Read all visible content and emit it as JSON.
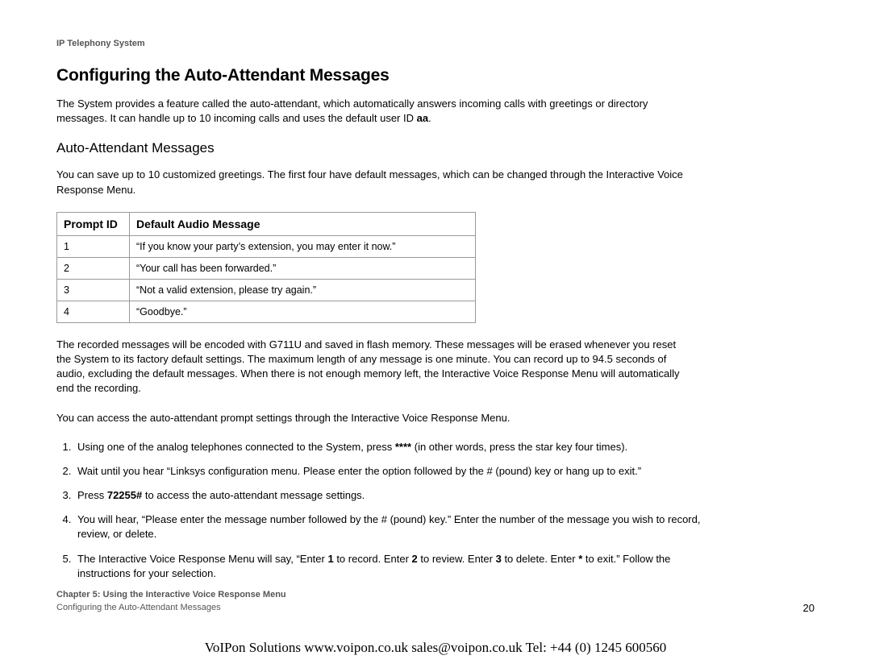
{
  "header_label": "IP Telephony System",
  "title": "Configuring the Auto-Attendant Messages",
  "intro_part1": "The System provides a feature called the auto-attendant, which automatically answers incoming calls with greetings or directory messages. It can handle up to 10 incoming calls and uses the default user ID ",
  "intro_bold": "aa",
  "intro_part2": ".",
  "subsection": "Auto-Attendant Messages",
  "save_text": "You can save up to 10 customized greetings. The first four have default messages, which can be changed through the Interactive Voice Response Menu.",
  "table": {
    "headers": {
      "col1": "Prompt ID",
      "col2": "Default Audio Message"
    },
    "rows": [
      {
        "id": "1",
        "msg": "“If you know your party’s extension, you may enter it now.”"
      },
      {
        "id": "2",
        "msg": "“Your call has been forwarded.”"
      },
      {
        "id": "3",
        "msg": "“Not a valid extension, please try again.”"
      },
      {
        "id": "4",
        "msg": "“Goodbye.”"
      }
    ]
  },
  "encoded_text": "The recorded messages will be encoded with G711U and saved in flash memory. These messages will be erased whenever you reset the System to its factory default settings. The maximum length of any message is one minute. You can record up to 94.5 seconds of audio, excluding the default messages. When there is not enough memory left, the Interactive Voice Response Menu will automatically end the recording.",
  "access_text": "You can access the auto-attendant prompt settings through the Interactive Voice Response Menu.",
  "steps": {
    "s1a": "Using one of the analog telephones connected to the System, press ",
    "s1b": "****",
    "s1c": " (in other words, press the star key four times).",
    "s2": "Wait until you hear “Linksys configuration menu. Please enter the option followed by the # (pound) key or hang up to exit.”",
    "s3a": "Press ",
    "s3b": "72255#",
    "s3c": " to access the auto-attendant message settings.",
    "s4": "You will hear, “Please enter the message number followed by the # (pound) key.” Enter the number of the message you wish to record, review, or delete.",
    "s5a": "The Interactive Voice Response Menu will say, “Enter ",
    "s5b": "1",
    "s5c": " to record. Enter ",
    "s5d": "2",
    "s5e": " to review. Enter ",
    "s5f": "3",
    "s5g": " to delete. Enter ",
    "s5h": "*",
    "s5i": " to exit.” Follow the instructions for your selection."
  },
  "footer": {
    "line1": "Chapter 5: Using the Interactive Voice Response Menu",
    "line2": "Configuring the Auto-Attendant Messages",
    "page": "20"
  },
  "bottom_bar": "VoIPon Solutions  www.voipon.co.uk  sales@voipon.co.uk  Tel: +44 (0) 1245 600560"
}
